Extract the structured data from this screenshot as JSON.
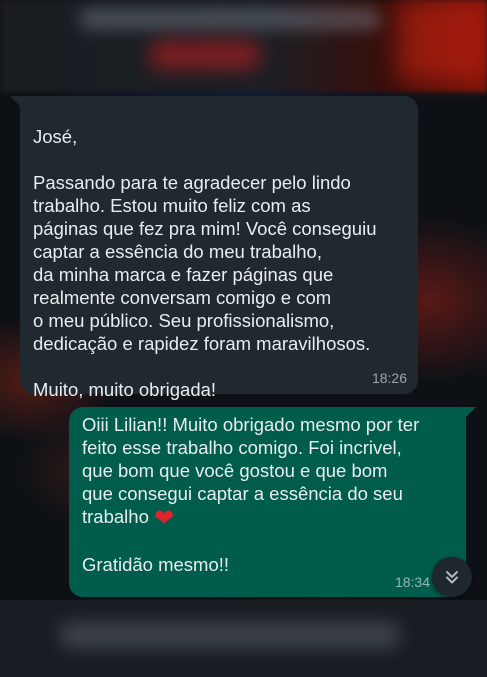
{
  "messages": {
    "incoming": {
      "text": "José,\n\nPassando para te agradecer pelo lindo\ntrabalho. Estou muito feliz com as\npáginas que fez pra mim! Você conseguiu\ncaptar a essência do meu trabalho,\nda minha marca e fazer páginas que\nrealmente conversam comigo e com\no meu público. Seu profissionalismo,\ndedicação e rapidez foram maravilhosos.\n\nMuito, muito obrigada!",
      "time": "18:26"
    },
    "outgoing": {
      "text": "Oiii Lilian!! Muito obrigado mesmo por ter\nfeito esse trabalho comigo. Foi incrivel,\nque bom que você gostou e que bom\nque consegui captar a essência do seu\ntrabalho ",
      "emoji": "❤",
      "text_after": "\n\nGratidão mesmo!!",
      "time": "18:34"
    }
  },
  "icons": {
    "scroll_down": "double-chevron-down-icon",
    "heart": "red-heart-emoji"
  },
  "colors": {
    "incoming_bubble": "#20292f",
    "outgoing_bubble": "#005c4b",
    "text": "#e9edef",
    "heart": "#e0242b"
  }
}
